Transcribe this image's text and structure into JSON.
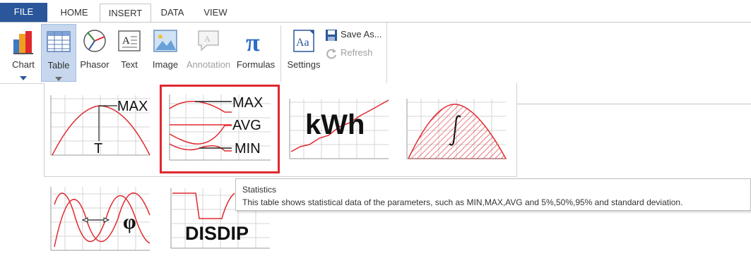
{
  "tabs": [
    {
      "label": "FILE"
    },
    {
      "label": "HOME"
    },
    {
      "label": "INSERT"
    },
    {
      "label": "DATA"
    },
    {
      "label": "VIEW"
    }
  ],
  "active_tab": "INSERT",
  "ribbon": {
    "chart": "Chart",
    "table": "Table",
    "phasor": "Phasor",
    "text": "Text",
    "image": "Image",
    "annotation": "Annotation",
    "formulas": "Formulas",
    "settings": "Settings",
    "save_as": "Save As...",
    "refresh": "Refresh"
  },
  "gallery": {
    "tile1": {
      "max": "MAX",
      "t": "T"
    },
    "tile2": {
      "max": "MAX",
      "avg": "AVG",
      "min": "MIN"
    },
    "tile3": {
      "text": "kWh"
    },
    "tile5": {
      "phi": "φ"
    },
    "tile6": {
      "text": "DISDIP"
    }
  },
  "tooltip": {
    "title": "Statistics",
    "body": "This table shows  statistical data of the parameters, such as MIN,MAX,AVG and 5%,50%,95% and standard deviation."
  },
  "colors": {
    "file_tab": "#2b579a",
    "selected_button": "#c6d7ee",
    "selection_outline": "#e0282e",
    "curve_red": "#e0282e"
  }
}
